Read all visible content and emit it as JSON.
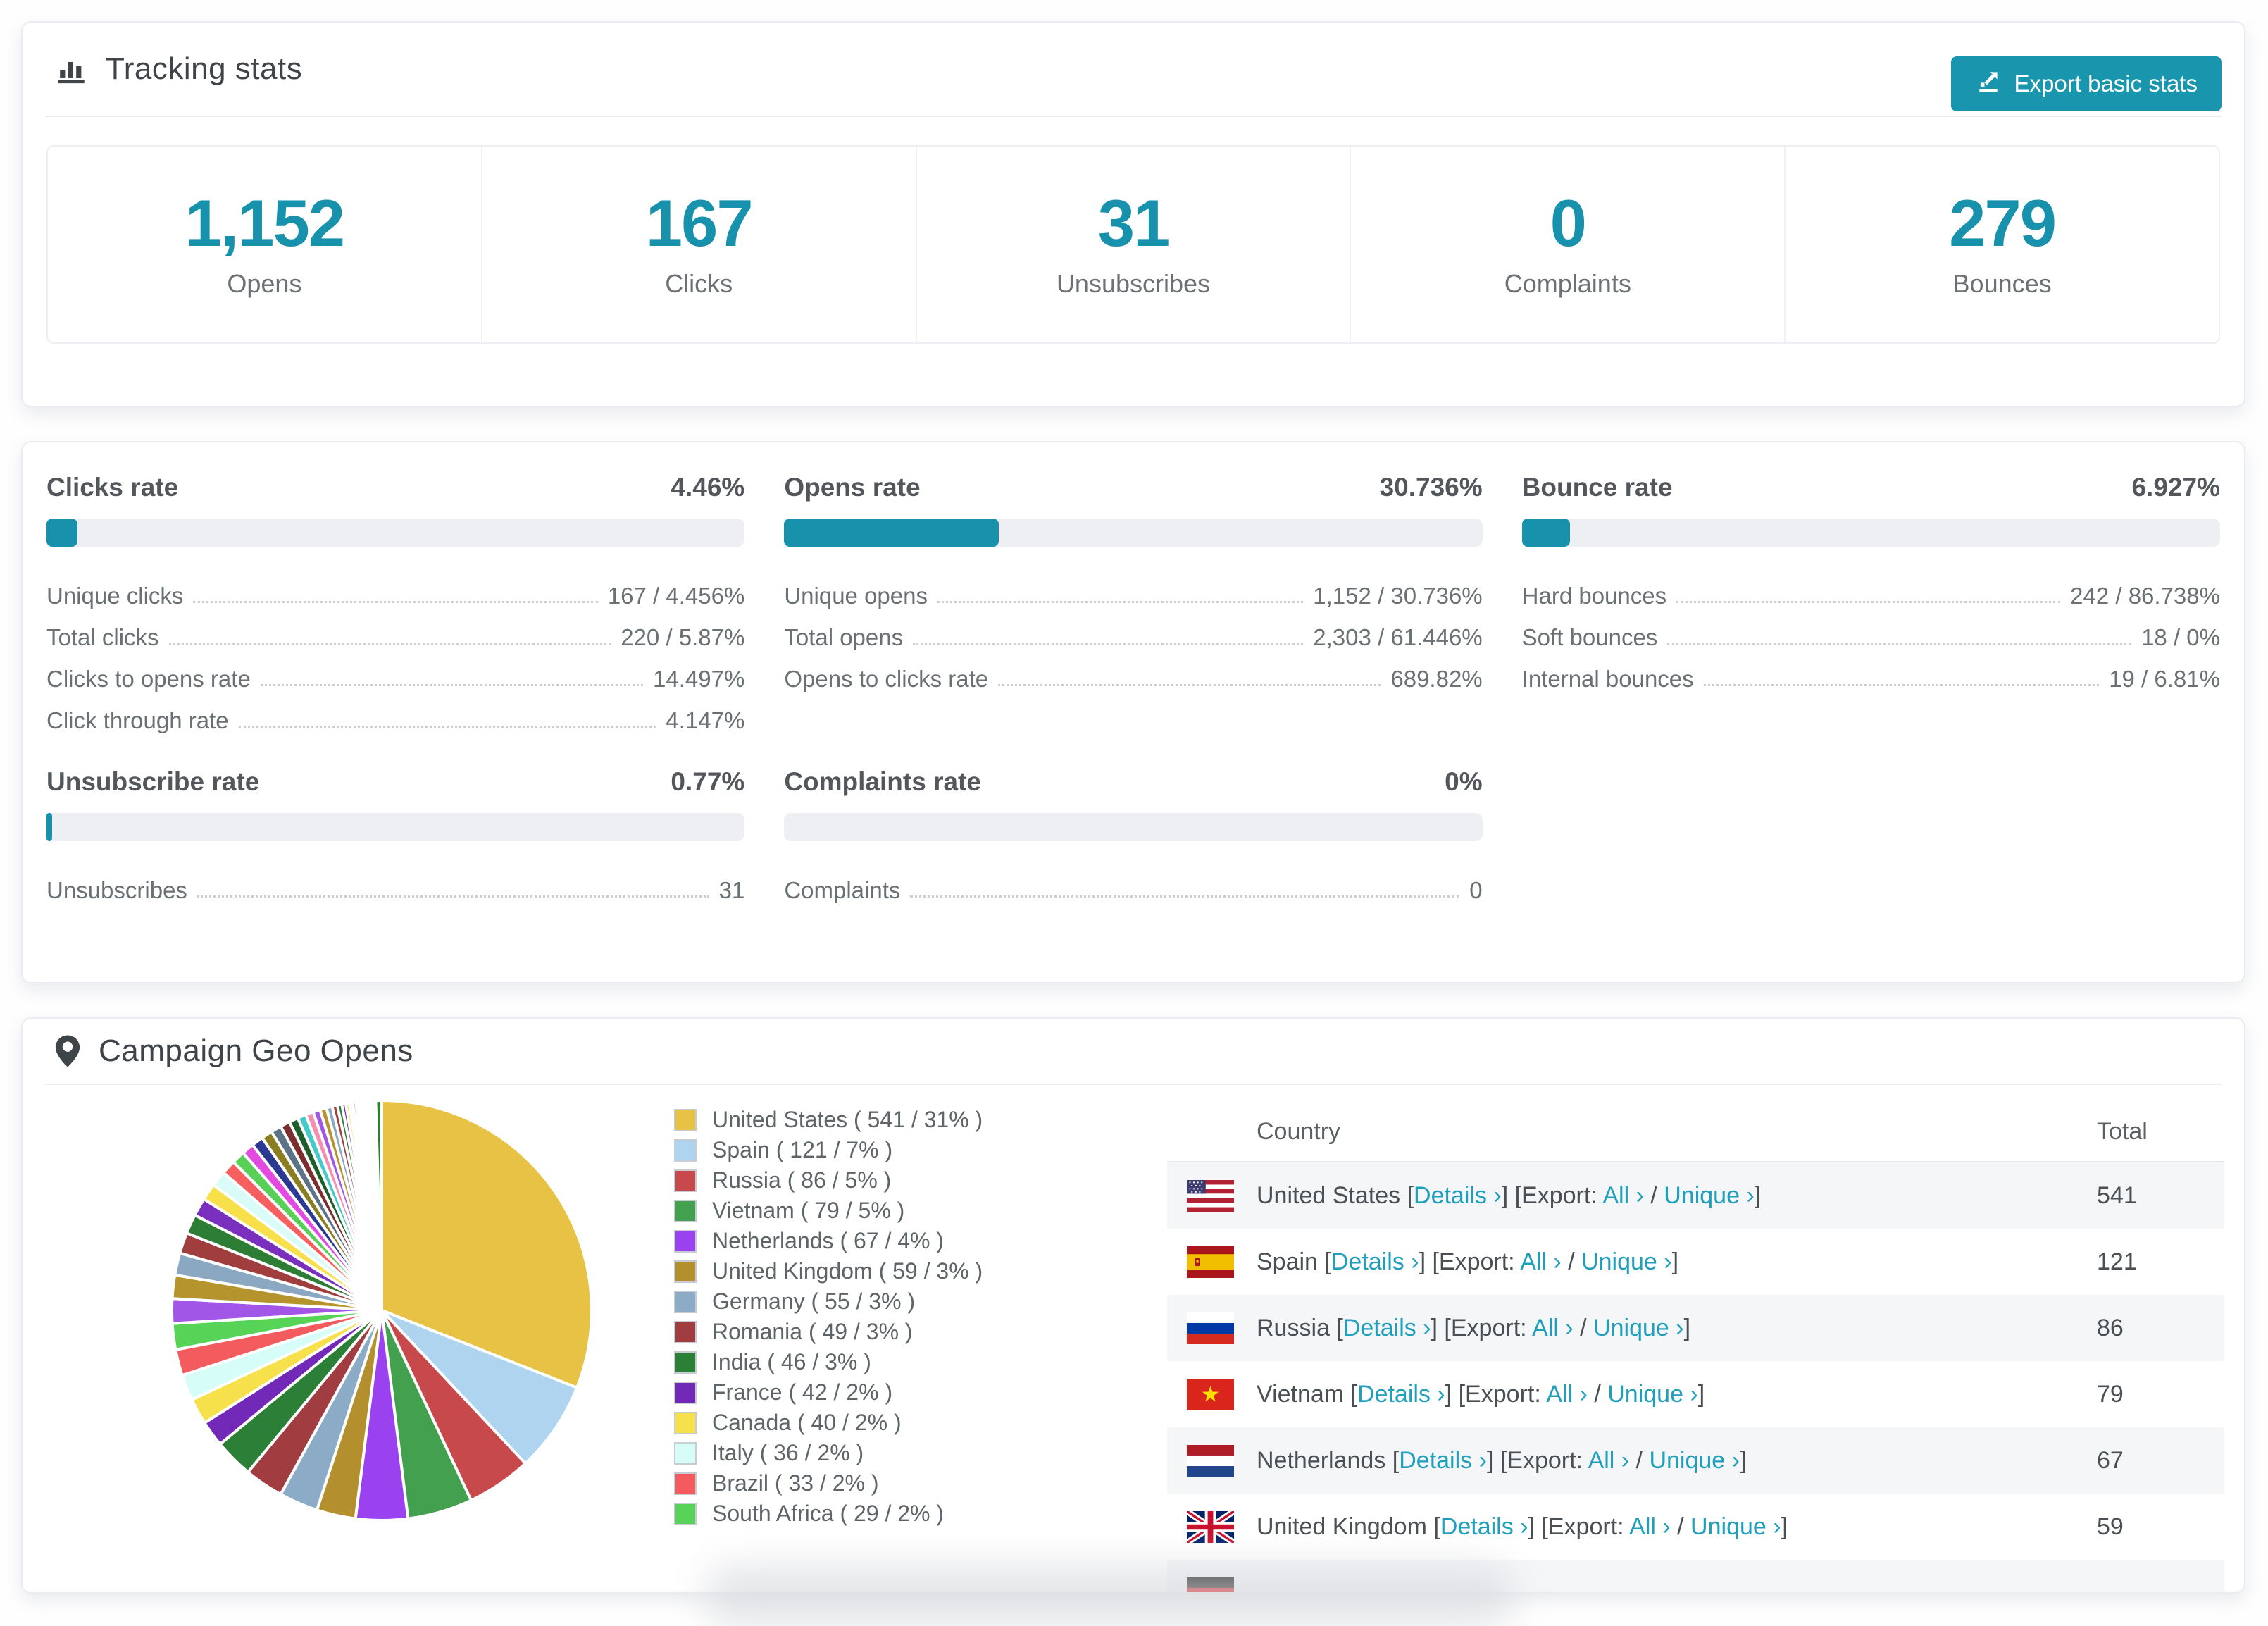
{
  "tracking_stats": {
    "title": "Tracking stats",
    "export_button_label": "Export basic stats",
    "summary": [
      {
        "value": "1,152",
        "label": "Opens"
      },
      {
        "value": "167",
        "label": "Clicks"
      },
      {
        "value": "31",
        "label": "Unsubscribes"
      },
      {
        "value": "0",
        "label": "Complaints"
      },
      {
        "value": "279",
        "label": "Bounces"
      }
    ]
  },
  "rates": [
    {
      "name": "Clicks rate",
      "value": "4.46%",
      "percent": 4.46,
      "rows": [
        {
          "label": "Unique clicks",
          "value": "167 / 4.456%"
        },
        {
          "label": "Total clicks",
          "value": "220 / 5.87%"
        },
        {
          "label": "Clicks to opens rate",
          "value": "14.497%"
        },
        {
          "label": "Click through rate",
          "value": "4.147%"
        }
      ]
    },
    {
      "name": "Opens rate",
      "value": "30.736%",
      "percent": 30.736,
      "rows": [
        {
          "label": "Unique opens",
          "value": "1,152 / 30.736%"
        },
        {
          "label": "Total opens",
          "value": "2,303 / 61.446%"
        },
        {
          "label": "Opens to clicks rate",
          "value": "689.82%"
        }
      ]
    },
    {
      "name": "Bounce rate",
      "value": "6.927%",
      "percent": 6.927,
      "rows": [
        {
          "label": "Hard bounces",
          "value": "242 / 86.738%"
        },
        {
          "label": "Soft bounces",
          "value": "18 / 0%"
        },
        {
          "label": "Internal bounces",
          "value": "19 / 6.81%"
        }
      ]
    },
    {
      "name": "Unsubscribe rate",
      "value": "0.77%",
      "percent": 0.77,
      "rows": [
        {
          "label": "Unsubscribes",
          "value": "31"
        }
      ]
    },
    {
      "name": "Complaints rate",
      "value": "0%",
      "percent": 0,
      "rows": [
        {
          "label": "Complaints",
          "value": "0"
        }
      ]
    }
  ],
  "geo": {
    "title": "Campaign Geo Opens",
    "chart_data": {
      "type": "pie",
      "title": "Campaign Geo Opens",
      "categories": [
        "United States",
        "Spain",
        "Russia",
        "Vietnam",
        "Netherlands",
        "United Kingdom",
        "Germany",
        "Romania",
        "India",
        "France",
        "Canada",
        "Italy",
        "Brazil",
        "South Africa"
      ],
      "values": [
        541,
        121,
        86,
        79,
        67,
        59,
        55,
        49,
        46,
        42,
        40,
        36,
        33,
        29
      ],
      "percents": [
        31,
        7,
        5,
        5,
        4,
        3,
        3,
        3,
        3,
        2,
        2,
        2,
        2,
        2
      ],
      "colors": [
        "#e7c244",
        "#aed4f0",
        "#c8494c",
        "#43a04e",
        "#9a41f0",
        "#b3902d",
        "#8cabc6",
        "#a13c40",
        "#2b7f36",
        "#7229b8",
        "#f6e04b",
        "#d7fdf9",
        "#f45b5e",
        "#57d457"
      ],
      "legend_position": "right",
      "start_angle_deg": 0,
      "direction": "clockwise",
      "unlabeled_slices_pct": [
        1.9,
        1.8,
        1.7,
        1.6,
        1.5,
        1.4,
        1.3,
        1.2,
        1.1,
        1.0,
        0.95,
        0.9,
        0.85,
        0.8,
        0.75,
        0.7,
        0.65,
        0.6,
        0.55,
        0.5,
        0.45,
        0.4,
        0.35,
        0.3,
        0.28,
        0.26,
        0.24,
        0.22,
        0.2,
        0.18,
        0.16,
        0.14,
        0.12,
        0.1,
        0.09,
        0.08,
        0.07,
        0.06,
        0.05,
        0.04,
        0.46
      ],
      "unlabeled_palette": [
        "#a256e8",
        "#b5942e",
        "#8aa8c2",
        "#a03d3d",
        "#2e7d34",
        "#7b2fbe",
        "#f7e049",
        "#d9fcf9",
        "#f55f5f",
        "#58d058",
        "#e24ae0",
        "#2b3990",
        "#8a7d22",
        "#5c7287",
        "#7c2d2d",
        "#1d5e2a",
        "#45c9c9",
        "#f58fb1"
      ]
    },
    "table": {
      "columns": [
        "Country",
        "Total"
      ],
      "labels": {
        "details": "Details",
        "export": "Export:",
        "all": "All",
        "unique": "Unique",
        "chevron": "›"
      },
      "rows": [
        {
          "country": "United States",
          "flag": "us",
          "total": "541"
        },
        {
          "country": "Spain",
          "flag": "es",
          "total": "121"
        },
        {
          "country": "Russia",
          "flag": "ru",
          "total": "86"
        },
        {
          "country": "Vietnam",
          "flag": "vn",
          "total": "79"
        },
        {
          "country": "Netherlands",
          "flag": "nl",
          "total": "67"
        },
        {
          "country": "United Kingdom",
          "flag": "gb",
          "total": "59"
        },
        {
          "country": "",
          "flag": "de",
          "total": "",
          "partial": true
        }
      ]
    }
  },
  "colors": {
    "accent_teal": "#1791ac",
    "button_teal": "#1995ae",
    "link_teal": "#1f9fbb",
    "bar_track": "#edeff2",
    "row_stripe": "#f5f6f8",
    "text_dark": "#3f4449",
    "text_gray": "#6b7074"
  }
}
